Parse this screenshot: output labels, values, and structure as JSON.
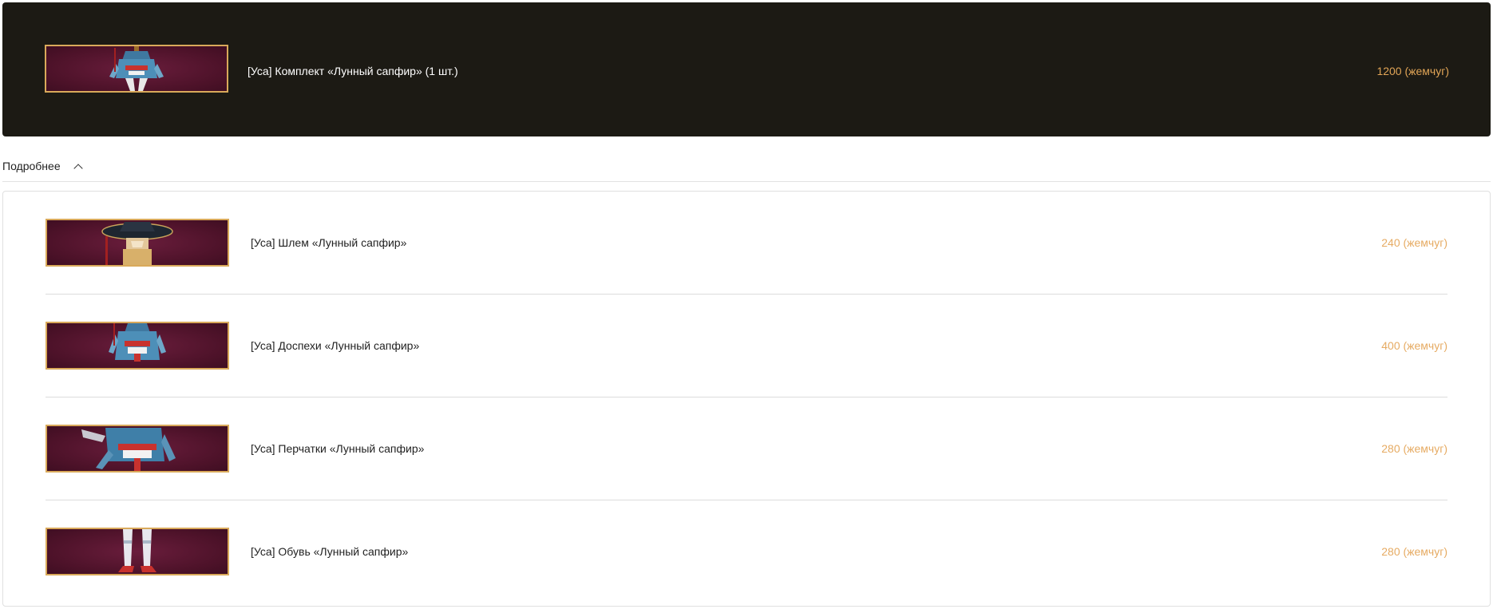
{
  "bundle": {
    "title": "[Уса] Комплект «Лунный сапфир» (1 шт.)",
    "price": "1200 (жемчуг)",
    "image_icon": "costume-set-icon"
  },
  "details_toggle": {
    "label": "Подробнее",
    "icon": "chevron-up-icon",
    "expanded": true
  },
  "items": [
    {
      "title": "[Уса] Шлем «Лунный сапфир»",
      "price": "240 (жемчуг)",
      "image_icon": "helmet-icon"
    },
    {
      "title": "[Уса] Доспехи «Лунный сапфир»",
      "price": "400 (жемчуг)",
      "image_icon": "armor-icon"
    },
    {
      "title": "[Уса] Перчатки «Лунный сапфир»",
      "price": "280 (жемчуг)",
      "image_icon": "gloves-icon"
    },
    {
      "title": "[Уса] Обувь «Лунный сапфир»",
      "price": "280 (жемчуг)",
      "image_icon": "boots-icon"
    }
  ],
  "colors": {
    "bundle_background": "#1c1a14",
    "price_accent": "#e0a456",
    "thumbnail_border": "#d9a95a",
    "thumbnail_background": "#5a1632"
  }
}
